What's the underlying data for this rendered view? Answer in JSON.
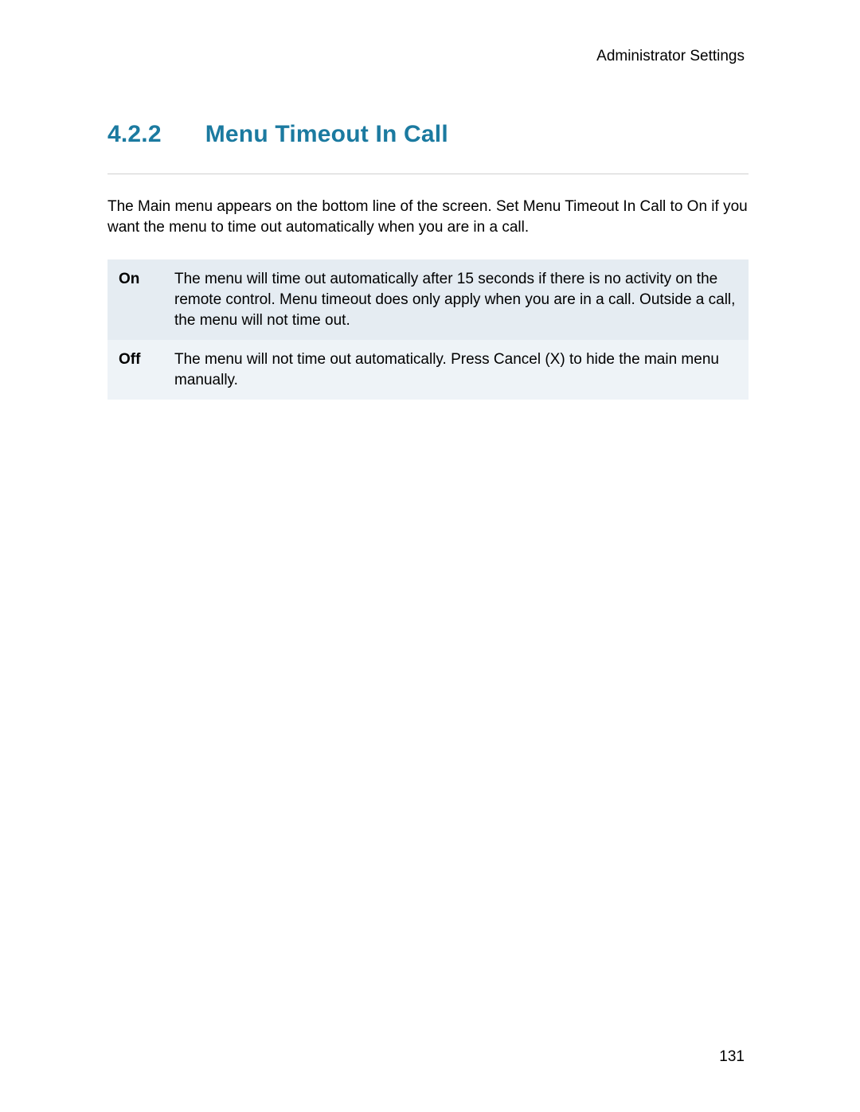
{
  "header": {
    "label": "Administrator Settings"
  },
  "section": {
    "number": "4.2.2",
    "title": "Menu Timeout In Call"
  },
  "intro": "The Main menu appears on the bottom line of the screen. Set Menu Timeout In Call to On if you want the menu to time out automatically when you are in a call.",
  "options": {
    "on": {
      "label": "On",
      "description": "The menu will time out automatically after 15 seconds if there is no activity on the remote control. Menu timeout does only apply when you are in a call. Outside a call, the menu will not time out."
    },
    "off": {
      "label": "Off",
      "description": "The menu will not time out automatically. Press Cancel (X) to hide the main menu manually."
    }
  },
  "footer": {
    "page_number": "131"
  }
}
